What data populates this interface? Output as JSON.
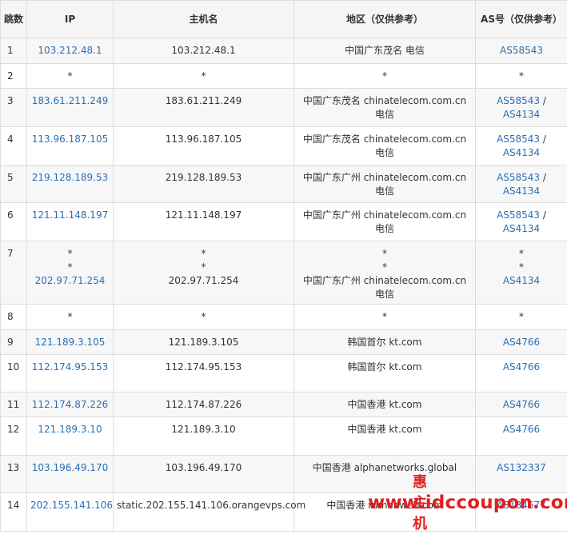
{
  "headers": {
    "hop": "跳数",
    "ip": "IP",
    "host": "主机名",
    "region": "地区（仅供参考）",
    "as": "AS号（仅供参考）"
  },
  "rows": [
    {
      "hop": "1",
      "ips": [
        "103.212.48.1"
      ],
      "hosts": [
        "103.212.48.1"
      ],
      "regions": [
        "中国广东茂名 电信"
      ],
      "as": [
        [
          "AS58543"
        ]
      ]
    },
    {
      "hop": "2",
      "ips": [
        "*"
      ],
      "hosts": [
        "*"
      ],
      "regions": [
        "*"
      ],
      "as": [
        [
          "*"
        ]
      ]
    },
    {
      "hop": "3",
      "ips": [
        "183.61.211.249"
      ],
      "hosts": [
        "183.61.211.249"
      ],
      "regions": [
        "中国广东茂名 chinatelecom.com.cn 电信"
      ],
      "as": [
        [
          "AS58543",
          "AS4134"
        ]
      ]
    },
    {
      "hop": "4",
      "ips": [
        "113.96.187.105"
      ],
      "hosts": [
        "113.96.187.105"
      ],
      "regions": [
        "中国广东茂名 chinatelecom.com.cn 电信"
      ],
      "as": [
        [
          "AS58543",
          "AS4134"
        ]
      ]
    },
    {
      "hop": "5",
      "ips": [
        "219.128.189.53"
      ],
      "hosts": [
        "219.128.189.53"
      ],
      "regions": [
        "中国广东广州 chinatelecom.com.cn 电信"
      ],
      "as": [
        [
          "AS58543",
          "AS4134"
        ]
      ]
    },
    {
      "hop": "6",
      "ips": [
        "121.11.148.197"
      ],
      "hosts": [
        "121.11.148.197"
      ],
      "regions": [
        "中国广东广州 chinatelecom.com.cn 电信"
      ],
      "as": [
        [
          "AS58543",
          "AS4134"
        ]
      ]
    },
    {
      "hop": "7",
      "ips": [
        "*",
        "*",
        "202.97.71.254"
      ],
      "hosts": [
        "*",
        "*",
        "202.97.71.254"
      ],
      "regions": [
        "*",
        "*",
        "中国广东广州 chinatelecom.com.cn 电信"
      ],
      "as": [
        [
          "*"
        ],
        [
          "*"
        ],
        [
          "AS4134"
        ]
      ]
    },
    {
      "hop": "8",
      "ips": [
        "*"
      ],
      "hosts": [
        "*"
      ],
      "regions": [
        "*"
      ],
      "as": [
        [
          "*"
        ]
      ]
    },
    {
      "hop": "9",
      "ips": [
        "121.189.3.105"
      ],
      "hosts": [
        "121.189.3.105"
      ],
      "regions": [
        "韩国首尔 kt.com"
      ],
      "as": [
        [
          "AS4766"
        ]
      ]
    },
    {
      "hop": "10",
      "ips": [
        "112.174.95.153"
      ],
      "hosts": [
        "112.174.95.153"
      ],
      "regions": [
        "韩国首尔 kt.com"
      ],
      "as": [
        [
          "AS4766"
        ]
      ]
    },
    {
      "hop": "11",
      "ips": [
        "112.174.87.226"
      ],
      "hosts": [
        "112.174.87.226"
      ],
      "regions": [
        "中国香港 kt.com"
      ],
      "as": [
        [
          "AS4766"
        ]
      ]
    },
    {
      "hop": "12",
      "ips": [
        "121.189.3.10"
      ],
      "hosts": [
        "121.189.3.10"
      ],
      "regions": [
        "中国香港 kt.com"
      ],
      "as": [
        [
          "AS4766"
        ]
      ]
    },
    {
      "hop": "13",
      "ips": [
        "103.196.49.170"
      ],
      "hosts": [
        "103.196.49.170"
      ],
      "regions": [
        "中国香港 alphanetworks.global"
      ],
      "as": [
        [
          "AS132337"
        ]
      ]
    },
    {
      "hop": "14",
      "ips": [
        "202.155.141.106"
      ],
      "hosts": [
        "static.202.155.141.106.orangevps.com"
      ],
      "regions": [
        "中国香港 rumahweb.com"
      ],
      "as": [
        [
          "AS134677"
        ]
      ]
    }
  ],
  "watermark": {
    "brand": "惠主机",
    "url": "www.idccoupon.com"
  },
  "colors": {
    "link": "#2a6fb5",
    "header_bg": "#f5f5f5",
    "row_alt_bg": "#f7f7f7",
    "border": "#dddddd",
    "watermark": "#e02020"
  }
}
